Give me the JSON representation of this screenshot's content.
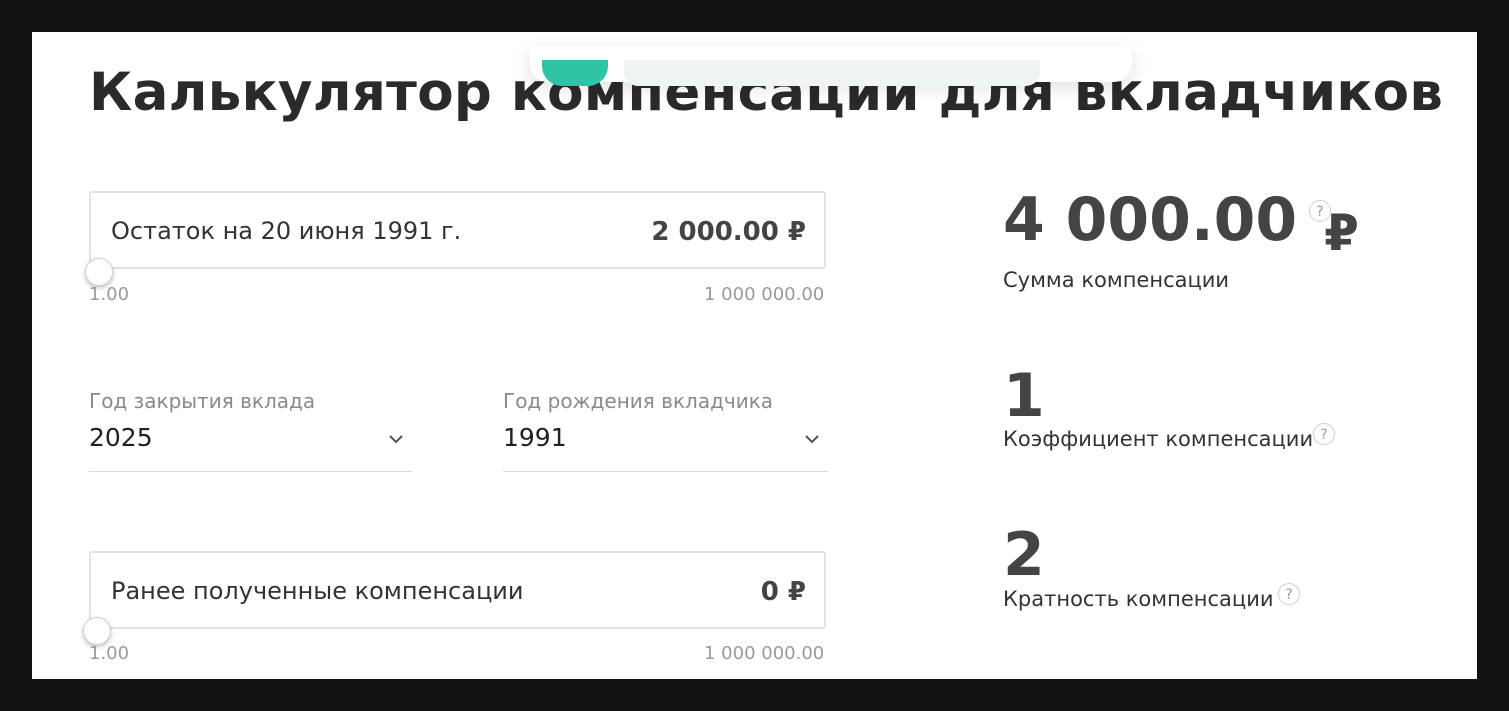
{
  "page": {
    "title": "Калькулятор компенсации для вкладчиков"
  },
  "balance_input": {
    "label": "Остаток на 20 июня 1991 г.",
    "value": "2 000.00 ₽",
    "slider": {
      "min": "1.00",
      "max": "1 000 000.00",
      "position_fraction": 0.002
    }
  },
  "close_year_select": {
    "label": "Год закрытия вклада",
    "value": "2025"
  },
  "birth_year_select": {
    "label": "Год рождения вкладчика",
    "value": "1991"
  },
  "previous_comp_input": {
    "label": "Ранее полученные компенсации",
    "value": "0 ₽",
    "slider": {
      "min": "1.00",
      "max": "1 000 000.00",
      "position_fraction": 0.0
    }
  },
  "results": {
    "sum": {
      "value": "4 000.00",
      "currency": "₽",
      "caption": "Сумма компенсации",
      "help_icon": "?"
    },
    "coefficient": {
      "value": "1",
      "caption": "Коэффициент компенсации",
      "help_icon": "?"
    },
    "multiplicity": {
      "value": "2",
      "caption": "Кратность компенсации",
      "help_icon": "?"
    }
  },
  "colors": {
    "accent": "#2ec4a6",
    "background": "#111111"
  }
}
